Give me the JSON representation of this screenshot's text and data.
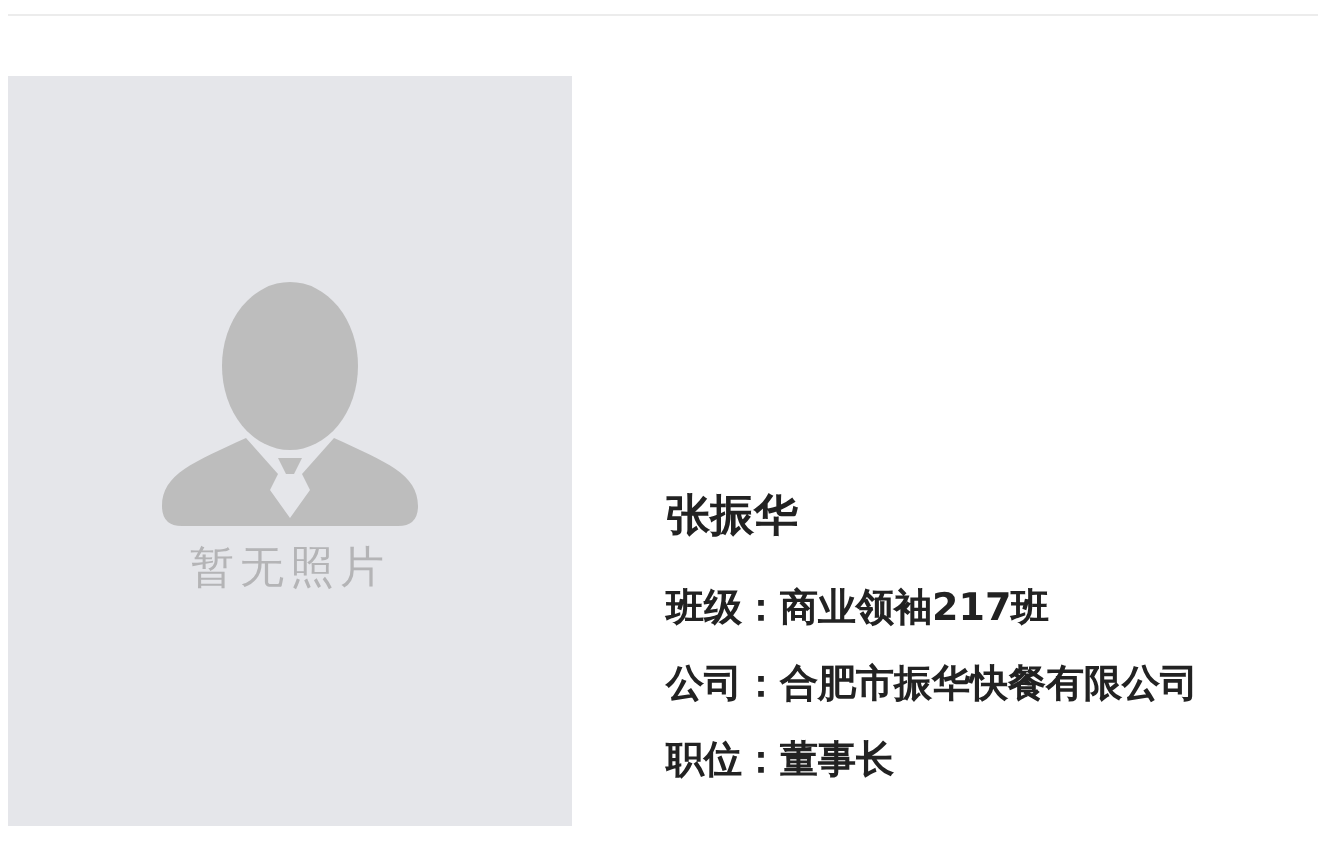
{
  "profile": {
    "photo": {
      "placeholder": "暂无照片"
    },
    "name": "张振华",
    "fields": [
      {
        "label": "班级：",
        "value": "商业领袖217班"
      },
      {
        "label": "公司：",
        "value": "合肥市振华快餐有限公司"
      },
      {
        "label": "职位：",
        "value": "董事长"
      }
    ]
  }
}
